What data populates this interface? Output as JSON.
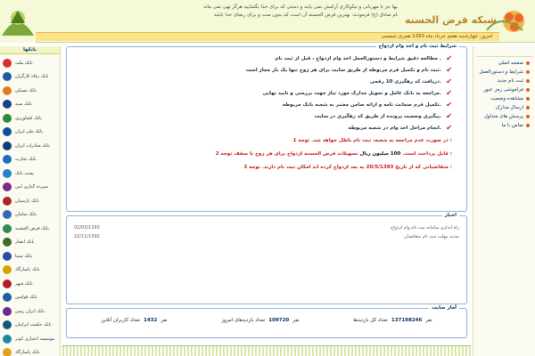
{
  "header": {
    "slogan_line1": "قلبها جز با مهربانی و نیکوکاری آرامش نمی یابند و دستی که برای خدا بگشایید هرگز تهی نمی ماند",
    "slogan_line2": "امام صادق (ع) فرمودند: بهترین قرض الحسنه آن است که بدون منت و برای رضای خدا باشد",
    "site_title": "شبکه قرض الحسنه",
    "date_text": "امروز: چهارشنبه هفتم خرداد ماه 1393 هجری شمسی"
  },
  "left_sidebar": {
    "title": "بانکها",
    "banks": [
      {
        "label": "بانک ملت",
        "color": "#d72f2f"
      },
      {
        "label": "بانک رفاه کارگران",
        "color": "#1d5aa8"
      },
      {
        "label": "بانک مسکن",
        "color": "#e07c1f"
      },
      {
        "label": "بانک سپه",
        "color": "#1b3f8f"
      },
      {
        "label": "بانک کشاورزی",
        "color": "#2c8b3a"
      },
      {
        "label": "بانک ملی ایران",
        "color": "#0b4f9e"
      },
      {
        "label": "بانک صادرات ایران",
        "color": "#0a3d7a"
      },
      {
        "label": "بانک تجارت",
        "color": "#1b6cc1"
      },
      {
        "label": "پست بانک",
        "color": "#2a7dd1"
      },
      {
        "label": "سپرده گذاری امن",
        "color": "#7a2a8b"
      },
      {
        "label": "بانک پارسیان",
        "color": "#b3231f"
      },
      {
        "label": "بانک سامان",
        "color": "#3a66b8"
      },
      {
        "label": "بانک قرض الحسنه",
        "color": "#2e8b57"
      },
      {
        "label": "بانک انصار",
        "color": "#3d6b2a"
      },
      {
        "label": "بانک سینا",
        "color": "#1f4f9e"
      },
      {
        "label": "بانک پاسارگاد",
        "color": "#d8a300"
      },
      {
        "label": "بانک شهر",
        "color": "#b01e2a"
      },
      {
        "label": "بانک قوامین",
        "color": "#1a5f9f"
      },
      {
        "label": "بانک ایران زمین",
        "color": "#6b2a8e"
      },
      {
        "label": "بانک حکمت ایرانیان",
        "color": "#0d5b7a"
      },
      {
        "label": "موسسه اعتباری کوثر",
        "color": "#1c8a9a"
      },
      {
        "label": "بانک پاسارگاد",
        "color": "#e3a21a"
      }
    ]
  },
  "right_sidebar": {
    "items": [
      {
        "label": "صفحه اصلی"
      },
      {
        "label": "شرایط و دستورالعمل"
      },
      {
        "label": "ثبت نام جدید"
      },
      {
        "label": "فراموشی رمز عبور"
      },
      {
        "label": "مشاهده وضعیت"
      },
      {
        "label": "ارسال مدارک"
      },
      {
        "label": "پرسش های متداول"
      },
      {
        "label": "تماس با ما"
      }
    ]
  },
  "rules_panel": {
    "title": "شرایط ثبت نام و اخذ وام ازدواج",
    "conditions": [
      "مطالعه دقیق شرایط و دستورالعمل اخذ وام ازدواج ، قبل از ثبت نام .",
      "ثبت نام و تکمیل فرم مربوطه از طریق سایت برای هر زوج تنها یک بار مجاز است.",
      "دریافت کد رهگیری 10 رقمی.",
      "مراجعه به بانک عامل و تحویل مدارک مورد نیاز جهت بررسی و تایید نهایی.",
      "تکمیل فرم ضمانت نامه و ارائه ضامن معتبر به شعبه بانک مربوطه.",
      "پیگیری وضعیت پرونده از طریق کد رهگیری در سایت.",
      "انجام مراحل اخذ وام در شعبه مربوطه."
    ],
    "notes": [
      {
        "prefix": "توجه 1 :",
        "text": "در صورت عدم مراجعه به شعبه، ثبت نام باطل خواهد شد."
      },
      {
        "prefix": "توجه 2 :",
        "text": "تسهیلات قرض الحسنه ازدواج برای هر زوج تا سقف",
        "amount": "100 میلیون ریال",
        "suffix": "قابل پرداخت است."
      },
      {
        "prefix": "توجه 3 :",
        "text": "متقاضیانی که از تاریخ 20/5/1393 به بعد ازدواج کرده اند امکان ثبت نام دارند."
      }
    ]
  },
  "news_panel": {
    "title": "اخبار",
    "items": [
      {
        "text": "راه اندازی سامانه ثبت نام وام ازدواج",
        "date": "02/03/1393"
      },
      {
        "text": "تمدید مهلت ثبت نام متقاضیان",
        "date": "22/11/1392"
      }
    ]
  },
  "stats_panel": {
    "title": "آمار سایت",
    "stats": [
      {
        "label": "تعداد کل بازدیدها",
        "value": "137198246",
        "unit": "نفر"
      },
      {
        "label": "تعداد بازدیدهای امروز",
        "value": "109720",
        "unit": "نفر"
      },
      {
        "label": "تعداد کاربران آنلاین",
        "value": "1432",
        "unit": "نفر"
      }
    ]
  },
  "colors": {
    "accent_red": "#c81919",
    "link_blue": "#003366",
    "header_bg": "#f6f9d8",
    "date_bar": "#fde38a"
  }
}
